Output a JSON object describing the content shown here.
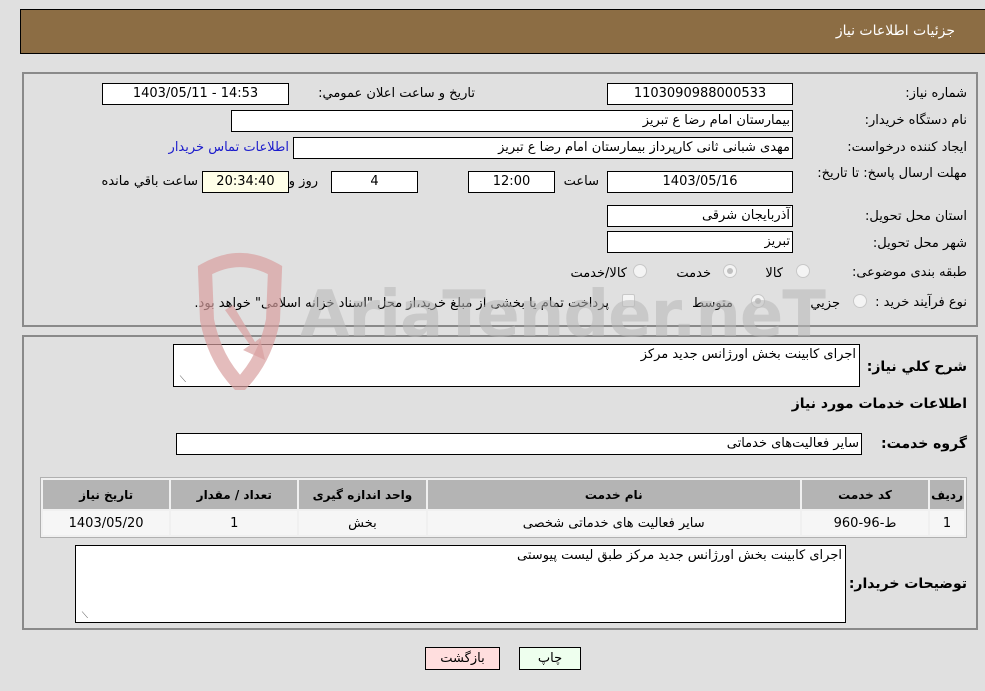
{
  "header": {
    "title": "جزئیات اطلاعات نیاز"
  },
  "form": {
    "need_number": {
      "label": "شماره نیاز:",
      "value": "1103090988000533"
    },
    "announce_datetime": {
      "label": "تاریخ و ساعت اعلان عمومي:",
      "value": "1403/05/11 - 14:53"
    },
    "buyer_org": {
      "label": "نام دستگاه خريدار:",
      "value": "بیمارستان امام رضا  ع  تبریز"
    },
    "requester": {
      "label": "ايجاد کننده درخواست:",
      "value": "مهدی شبانی ثانی کارپرداز بیمارستان امام رضا  ع  تبریز",
      "link": "اطلاعات تماس خريدار"
    },
    "deadline": {
      "label": "مهلت ارسال پاسخ: تا تاریخ:",
      "date": "1403/05/16",
      "time_label": "ساعت",
      "time": "12:00",
      "days": "4",
      "days_label": "روز و",
      "remaining": "20:34:40",
      "remaining_label": "ساعت باقي مانده"
    },
    "province": {
      "label": "استان محل تحويل:",
      "value": "آذربایجان شرقی"
    },
    "city": {
      "label": "شهر محل تحويل:",
      "value": "تبریز"
    },
    "category": {
      "label": "طبقه بندی موضوعی:",
      "options": [
        "کالا",
        "خدمت",
        "کالا/خدمت"
      ],
      "selected": "خدمت"
    },
    "purchase_type": {
      "label": "نوع فرآیند خرید :",
      "options": [
        "جزيي",
        "متوسط"
      ],
      "selected": "متوسط",
      "treasury_note": "پرداخت تمام يا بخشی از مبلغ خريد،از محل \"اسناد خزانه اسلامی\" خواهد بود."
    }
  },
  "details": {
    "summary_label": "شرح کلي نياز:",
    "summary": "اجرای کابینت بخش اورژانس جدید مرکز",
    "services_title": "اطلاعات خدمات مورد نياز",
    "service_group_label": "گروه خدمت:",
    "service_group": "سایر فعالیت‌های خدماتی",
    "table": {
      "headers": [
        "رديف",
        "کد خدمت",
        "نام خدمت",
        "واحد اندازه گيری",
        "تعداد / مقدار",
        "تاريخ نياز"
      ],
      "rows": [
        [
          "1",
          "ط-96-960",
          "سایر فعالیت های خدماتی شخصی",
          "بخش",
          "1",
          "1403/05/20"
        ]
      ]
    },
    "buyer_notes_label": "توضيحات خريدار:",
    "buyer_notes": "اجرای کابینت بخش اورژانس جدید مرکز طبق لیست پیوستی"
  },
  "buttons": {
    "print": "چاپ",
    "back": "بازگشت"
  },
  "watermark": {
    "text": "AriaTender.neT",
    "colors": {
      "shield": "#d9a0a0",
      "text": "#b8b8b8"
    }
  }
}
